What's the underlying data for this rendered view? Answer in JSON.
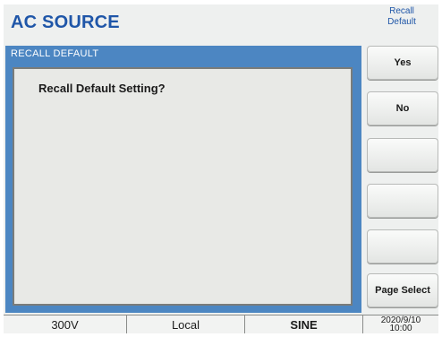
{
  "header": {
    "title": "AC SOURCE"
  },
  "panel": {
    "title": "RECALL DEFAULT",
    "prompt": "Recall Default Setting?"
  },
  "softkeys": {
    "menu_title_line1": "Recall",
    "menu_title_line2": "Default",
    "buttons": [
      "Yes",
      "No",
      "",
      "",
      "",
      "Page Select"
    ]
  },
  "status_bar": {
    "range": "300V",
    "mode": "Local",
    "waveform": "SINE",
    "date": "2020/9/10",
    "time": "10:00"
  },
  "colors": {
    "title": "#1f56a8",
    "panel_bg": "#4c86c2",
    "screen_bg": "#eef0ef"
  }
}
